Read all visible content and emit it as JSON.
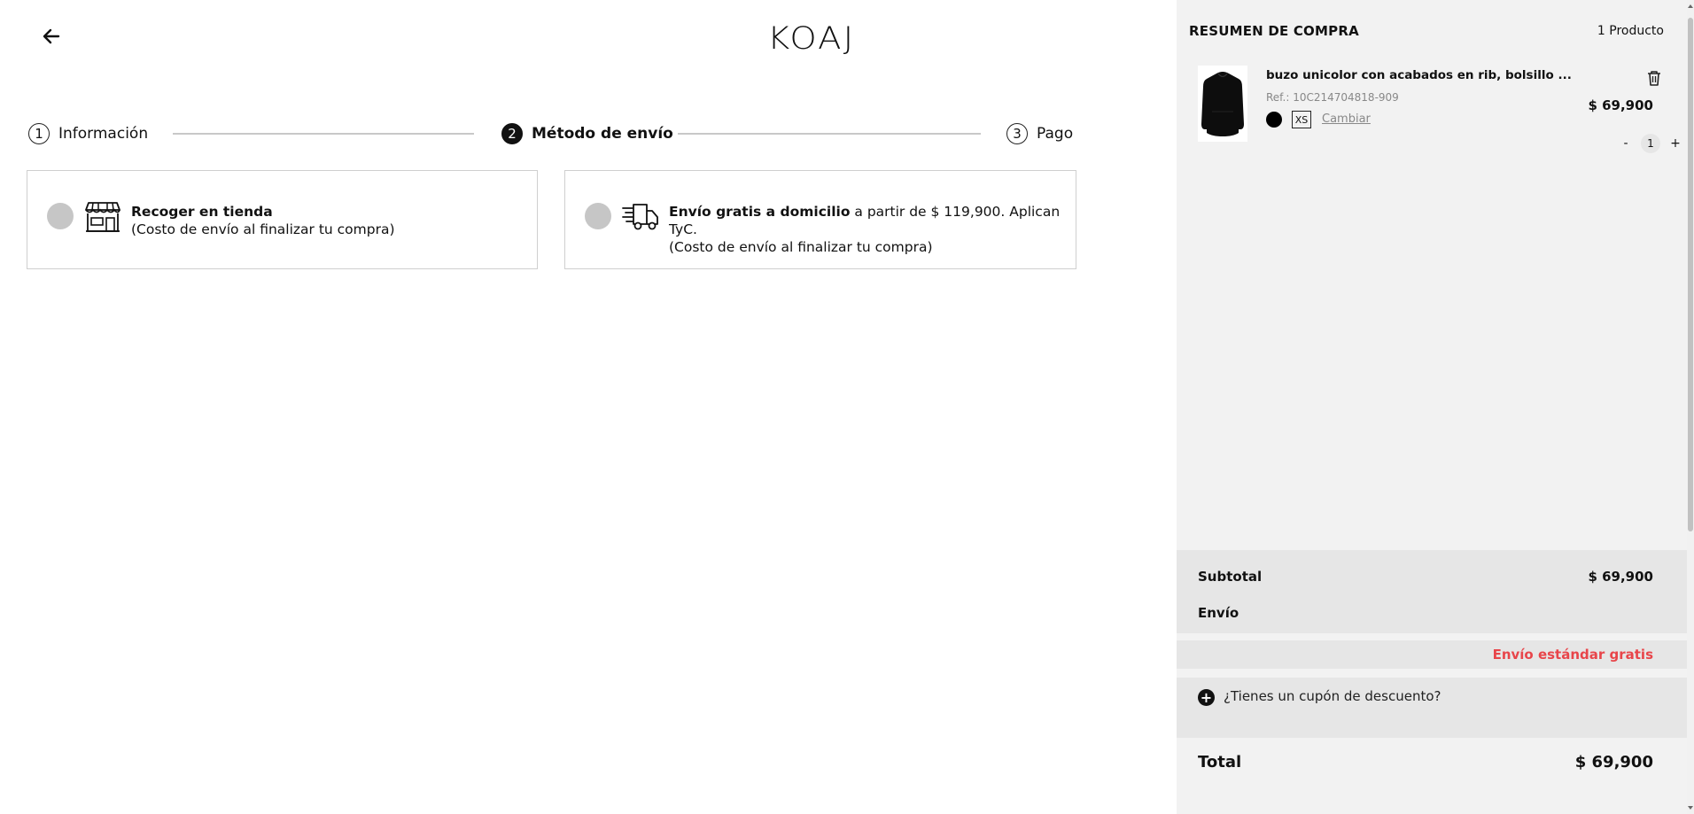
{
  "header": {
    "logo": "KOAJ"
  },
  "steps": [
    {
      "num": "1",
      "label": "Información"
    },
    {
      "num": "2",
      "label": "Método de envío"
    },
    {
      "num": "3",
      "label": "Pago"
    }
  ],
  "shipping_options": [
    {
      "title": "Recoger en tienda",
      "rest": "",
      "note": "(Costo de envío al finalizar tu compra)"
    },
    {
      "title": "Envío gratis a domicilio",
      "rest": " a partir de $ 119,900. Aplican TyC.",
      "note": "(Costo de envío al finalizar tu compra)"
    }
  ],
  "summary": {
    "title": "RESUMEN DE COMPRA",
    "count": "1 Producto",
    "product": {
      "name": "buzo unicolor con acabados en rib, bolsillo ...",
      "ref": "Ref.: 10C214704818-909",
      "size": "XS",
      "change_label": "Cambiar",
      "price": "$ 69,900",
      "qty_minus": "-",
      "qty": "1",
      "qty_plus": "+",
      "color": "#000000"
    },
    "subtotal_label": "Subtotal",
    "subtotal_value": "$ 69,900",
    "shipping_label": "Envío",
    "free_shipping": "Envío estándar gratis",
    "coupon_text": "¿Tienes un cupón de descuento?",
    "total_label": "Total",
    "total_value": "$ 69,900"
  },
  "colors": {
    "accent_red": "#e8454a",
    "panel_bg": "#f2f2f2",
    "row_bg": "#e6e6e6"
  }
}
